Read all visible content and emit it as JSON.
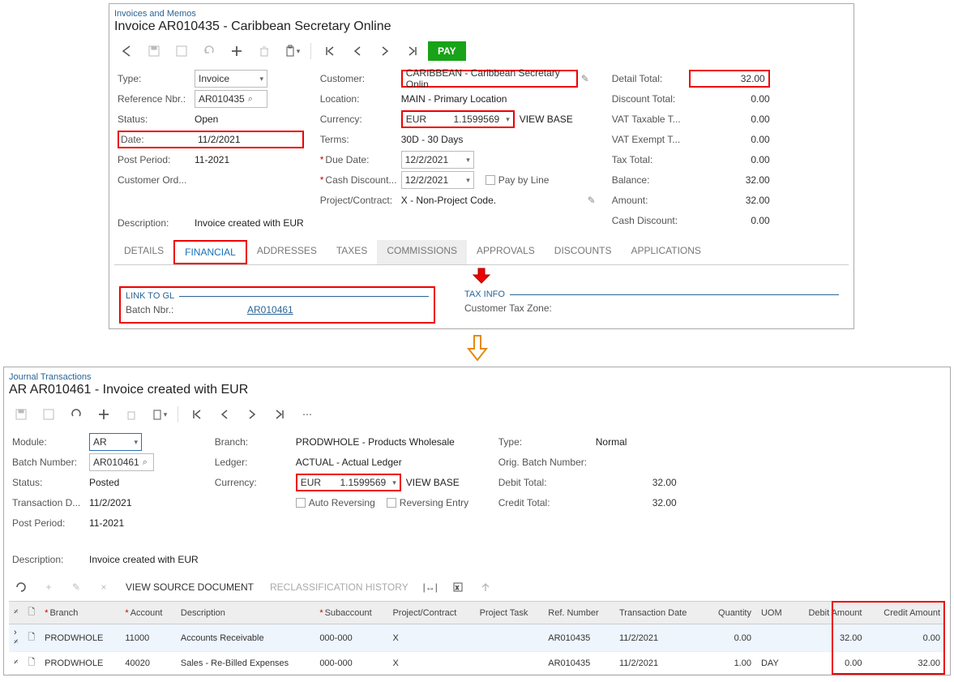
{
  "invoice": {
    "breadcrumb": "Invoices and Memos",
    "title": "Invoice AR010435 - Caribbean Secretary Online",
    "pay_btn": "PAY",
    "form": {
      "type_label": "Type:",
      "type_value": "Invoice",
      "ref_label": "Reference Nbr.:",
      "ref_value": "AR010435",
      "status_label": "Status:",
      "status_value": "Open",
      "date_label": "Date:",
      "date_value": "11/2/2021",
      "postperiod_label": "Post Period:",
      "postperiod_value": "11-2021",
      "custord_label": "Customer Ord...",
      "desc_label": "Description:",
      "desc_value": "Invoice created with EUR",
      "customer_label": "Customer:",
      "customer_value": "CARIBBEAN - Caribbean Secretary Onlin",
      "location_label": "Location:",
      "location_value": "MAIN - Primary Location",
      "currency_label": "Currency:",
      "currency_code": "EUR",
      "currency_rate": "1.1599569",
      "viewbase": "VIEW BASE",
      "terms_label": "Terms:",
      "terms_value": "30D - 30 Days",
      "duedate_label": "Due Date:",
      "duedate_value": "12/2/2021",
      "cashdisc_label": "Cash Discount...",
      "cashdisc_value": "12/2/2021",
      "paybyline_label": "Pay by Line",
      "project_label": "Project/Contract:",
      "project_value": "X - Non-Project Code.",
      "detailtotal_label": "Detail Total:",
      "detailtotal_value": "32.00",
      "discounttotal_label": "Discount Total:",
      "discounttotal_value": "0.00",
      "vattax_label": "VAT Taxable T...",
      "vattax_value": "0.00",
      "vatexempt_label": "VAT Exempt T...",
      "vatexempt_value": "0.00",
      "taxtotal_label": "Tax Total:",
      "taxtotal_value": "0.00",
      "balance_label": "Balance:",
      "balance_value": "32.00",
      "amount_label": "Amount:",
      "amount_value": "32.00",
      "cashdiscount_label": "Cash Discount:",
      "cashdiscount_value": "0.00"
    },
    "tabs": {
      "details": "DETAILS",
      "financial": "FINANCIAL",
      "addresses": "ADDRESSES",
      "taxes": "TAXES",
      "commissions": "COMMISSIONS",
      "approvals": "APPROVALS",
      "discounts": "DISCOUNTS",
      "applications": "APPLICATIONS"
    },
    "financial": {
      "linktogl": "LINK TO GL",
      "batch_label": "Batch Nbr.:",
      "batch_value": "AR010461",
      "taxinfo": "TAX INFO",
      "custtaxzone_label": "Customer Tax Zone:"
    }
  },
  "journal": {
    "breadcrumb": "Journal Transactions",
    "title": "AR AR010461 - Invoice created with EUR",
    "form": {
      "module_label": "Module:",
      "module_value": "AR",
      "batch_label": "Batch Number:",
      "batch_value": "AR010461",
      "status_label": "Status:",
      "status_value": "Posted",
      "transdate_label": "Transaction D...",
      "transdate_value": "11/2/2021",
      "postperiod_label": "Post Period:",
      "postperiod_value": "11-2021",
      "desc_label": "Description:",
      "desc_value": "Invoice created with EUR",
      "branch_label": "Branch:",
      "branch_value": "PRODWHOLE - Products Wholesale",
      "ledger_label": "Ledger:",
      "ledger_value": "ACTUAL - Actual Ledger",
      "currency_label": "Currency:",
      "currency_code": "EUR",
      "currency_rate": "1.1599569",
      "viewbase": "VIEW BASE",
      "autorev_label": "Auto Reversing",
      "reventry_label": "Reversing Entry",
      "type_label": "Type:",
      "type_value": "Normal",
      "origbatch_label": "Orig. Batch Number:",
      "debittotal_label": "Debit Total:",
      "debittotal_value": "32.00",
      "credittotal_label": "Credit Total:",
      "credittotal_value": "32.00"
    },
    "grid_toolbar": {
      "viewsource": "VIEW SOURCE DOCUMENT",
      "reclass": "RECLASSIFICATION HISTORY"
    },
    "grid": {
      "cols": {
        "branch": "Branch",
        "account": "Account",
        "description": "Description",
        "subaccount": "Subaccount",
        "project": "Project/Contract",
        "task": "Project Task",
        "refnbr": "Ref. Number",
        "transdate": "Transaction Date",
        "qty": "Quantity",
        "uom": "UOM",
        "debit": "Debit Amount",
        "credit": "Credit Amount"
      },
      "rows": [
        {
          "branch": "PRODWHOLE",
          "account": "11000",
          "description": "Accounts Receivable",
          "subaccount": "000-000",
          "project": "X",
          "task": "",
          "refnbr": "AR010435",
          "transdate": "11/2/2021",
          "qty": "0.00",
          "uom": "",
          "debit": "32.00",
          "credit": "0.00"
        },
        {
          "branch": "PRODWHOLE",
          "account": "40020",
          "description": "Sales - Re-Billed Expenses",
          "subaccount": "000-000",
          "project": "X",
          "task": "",
          "refnbr": "AR010435",
          "transdate": "11/2/2021",
          "qty": "1.00",
          "uom": "DAY",
          "debit": "0.00",
          "credit": "32.00"
        }
      ]
    }
  }
}
